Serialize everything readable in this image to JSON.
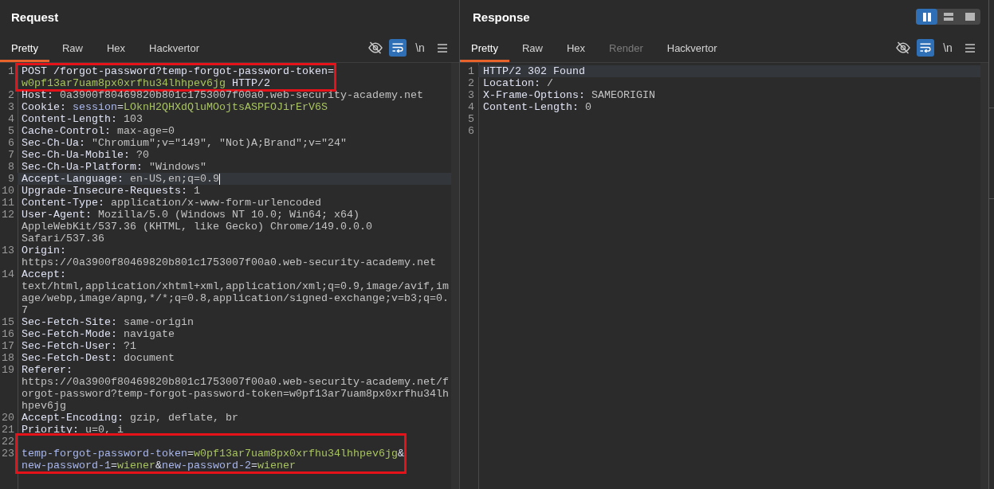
{
  "request": {
    "title": "Request",
    "focused": true,
    "tabs": [
      {
        "label": "Pretty",
        "selected": true,
        "disabled": false
      },
      {
        "label": "Raw",
        "selected": false,
        "disabled": false
      },
      {
        "label": "Hex",
        "selected": false,
        "disabled": false
      },
      {
        "label": "Hackvertor",
        "selected": false,
        "disabled": false
      }
    ],
    "toolbar": [
      {
        "kind": "hide",
        "on": false
      },
      {
        "kind": "wrap",
        "on": true
      },
      {
        "kind": "newline",
        "label": "\\n",
        "on": false
      },
      {
        "kind": "menu"
      }
    ],
    "groups": [
      {
        "boxed": true,
        "lines": [
          {
            "number": "1",
            "current": false,
            "rows": [
              {
                "parts": [
                  {
                    "kind": "name",
                    "text": "POST /forgot-password?temp-forgot-password-token="
                  }
                ]
              },
              {
                "parts": [
                  {
                    "kind": "value",
                    "text": "w0pf13ar7uam8px0xrfhu34lhhpev6jg"
                  },
                  {
                    "kind": "name",
                    "text": " HTTP/2"
                  }
                ]
              }
            ]
          }
        ]
      },
      {
        "boxed": false,
        "lines": [
          {
            "number": "2",
            "current": false,
            "rows": [
              {
                "parts": [
                  {
                    "kind": "name",
                    "text": "Host:"
                  },
                  {
                    "kind": "plain",
                    "text": " 0a3900f80469820b801c1753007f00a0.web-security-academy.net"
                  }
                ]
              }
            ]
          },
          {
            "number": "3",
            "current": false,
            "rows": [
              {
                "parts": [
                  {
                    "kind": "name",
                    "text": "Cookie: "
                  },
                  {
                    "kind": "param",
                    "text": "session"
                  },
                  {
                    "kind": "name",
                    "text": "="
                  },
                  {
                    "kind": "value",
                    "text": "LOknH2QHXdQluMOojtsASPFOJirErV6S"
                  }
                ]
              }
            ]
          },
          {
            "number": "4",
            "current": false,
            "rows": [
              {
                "parts": [
                  {
                    "kind": "name",
                    "text": "Content-Length:"
                  },
                  {
                    "kind": "plain",
                    "text": " 103"
                  }
                ]
              }
            ]
          },
          {
            "number": "5",
            "current": false,
            "rows": [
              {
                "parts": [
                  {
                    "kind": "name",
                    "text": "Cache-Control:"
                  },
                  {
                    "kind": "plain",
                    "text": " max-age=0"
                  }
                ]
              }
            ]
          },
          {
            "number": "6",
            "current": false,
            "rows": [
              {
                "parts": [
                  {
                    "kind": "name",
                    "text": "Sec-Ch-Ua:"
                  },
                  {
                    "kind": "plain",
                    "text": " \"Chromium\";v=\"149\", \"Not)A;Brand\";v=\"24\""
                  }
                ]
              }
            ]
          },
          {
            "number": "7",
            "current": false,
            "rows": [
              {
                "parts": [
                  {
                    "kind": "name",
                    "text": "Sec-Ch-Ua-Mobile:"
                  },
                  {
                    "kind": "plain",
                    "text": " ?0"
                  }
                ]
              }
            ]
          },
          {
            "number": "8",
            "current": false,
            "rows": [
              {
                "parts": [
                  {
                    "kind": "name",
                    "text": "Sec-Ch-Ua-Platform:"
                  },
                  {
                    "kind": "plain",
                    "text": " \"Windows\""
                  }
                ]
              }
            ]
          },
          {
            "number": "9",
            "current": true,
            "rows": [
              {
                "parts": [
                  {
                    "kind": "name",
                    "text": "Accept-Language:"
                  },
                  {
                    "kind": "plain",
                    "text": " en-US,en;q=0.9"
                  }
                ]
              }
            ]
          },
          {
            "number": "10",
            "current": false,
            "rows": [
              {
                "parts": [
                  {
                    "kind": "name",
                    "text": "Upgrade-Insecure-Requests:"
                  },
                  {
                    "kind": "plain",
                    "text": " 1"
                  }
                ]
              }
            ]
          },
          {
            "number": "11",
            "current": false,
            "rows": [
              {
                "parts": [
                  {
                    "kind": "name",
                    "text": "Content-Type:"
                  },
                  {
                    "kind": "plain",
                    "text": " application/x-www-form-urlencoded"
                  }
                ]
              }
            ]
          },
          {
            "number": "12",
            "current": false,
            "rows": [
              {
                "parts": [
                  {
                    "kind": "name",
                    "text": "User-Agent:"
                  },
                  {
                    "kind": "plain",
                    "text": " Mozilla/5.0 (Windows NT 10.0; Win64; x64)"
                  }
                ]
              },
              {
                "parts": [
                  {
                    "kind": "plain",
                    "text": "AppleWebKit/537.36 (KHTML, like Gecko) Chrome/149.0.0.0"
                  }
                ]
              },
              {
                "parts": [
                  {
                    "kind": "plain",
                    "text": "Safari/537.36"
                  }
                ]
              }
            ]
          },
          {
            "number": "13",
            "current": false,
            "rows": [
              {
                "parts": [
                  {
                    "kind": "name",
                    "text": "Origin:"
                  }
                ]
              },
              {
                "parts": [
                  {
                    "kind": "plain",
                    "text": "https://0a3900f80469820b801c1753007f00a0.web-security-academy.net"
                  }
                ]
              }
            ]
          },
          {
            "number": "14",
            "current": false,
            "rows": [
              {
                "parts": [
                  {
                    "kind": "name",
                    "text": "Accept:"
                  }
                ]
              },
              {
                "parts": [
                  {
                    "kind": "plain",
                    "text": "text/html,application/xhtml+xml,application/xml;q=0.9,image/avif,im"
                  }
                ]
              },
              {
                "parts": [
                  {
                    "kind": "plain",
                    "text": "age/webp,image/apng,*/*;q=0.8,application/signed-exchange;v=b3;q=0."
                  }
                ]
              },
              {
                "parts": [
                  {
                    "kind": "plain",
                    "text": "7"
                  }
                ]
              }
            ]
          },
          {
            "number": "15",
            "current": false,
            "rows": [
              {
                "parts": [
                  {
                    "kind": "name",
                    "text": "Sec-Fetch-Site:"
                  },
                  {
                    "kind": "plain",
                    "text": " same-origin"
                  }
                ]
              }
            ]
          },
          {
            "number": "16",
            "current": false,
            "rows": [
              {
                "parts": [
                  {
                    "kind": "name",
                    "text": "Sec-Fetch-Mode:"
                  },
                  {
                    "kind": "plain",
                    "text": " navigate"
                  }
                ]
              }
            ]
          },
          {
            "number": "17",
            "current": false,
            "rows": [
              {
                "parts": [
                  {
                    "kind": "name",
                    "text": "Sec-Fetch-User:"
                  },
                  {
                    "kind": "plain",
                    "text": " ?1"
                  }
                ]
              }
            ]
          },
          {
            "number": "18",
            "current": false,
            "rows": [
              {
                "parts": [
                  {
                    "kind": "name",
                    "text": "Sec-Fetch-Dest:"
                  },
                  {
                    "kind": "plain",
                    "text": " document"
                  }
                ]
              }
            ]
          },
          {
            "number": "19",
            "current": false,
            "rows": [
              {
                "parts": [
                  {
                    "kind": "name",
                    "text": "Referer:"
                  }
                ]
              },
              {
                "parts": [
                  {
                    "kind": "plain",
                    "text": "https://0a3900f80469820b801c1753007f00a0.web-security-academy.net/f"
                  }
                ]
              },
              {
                "parts": [
                  {
                    "kind": "plain",
                    "text": "orgot-password?temp-forgot-password-token=w0pf13ar7uam8px0xrfhu34lh"
                  }
                ]
              },
              {
                "parts": [
                  {
                    "kind": "plain",
                    "text": "hpev6jg"
                  }
                ]
              }
            ]
          },
          {
            "number": "20",
            "current": false,
            "rows": [
              {
                "parts": [
                  {
                    "kind": "name",
                    "text": "Accept-Encoding:"
                  },
                  {
                    "kind": "plain",
                    "text": " gzip, deflate, br"
                  }
                ]
              }
            ]
          },
          {
            "number": "21",
            "current": false,
            "rows": [
              {
                "parts": [
                  {
                    "kind": "name",
                    "text": "Priority:"
                  },
                  {
                    "kind": "plain",
                    "text": " u=0, i"
                  }
                ]
              }
            ]
          }
        ]
      },
      {
        "boxed": true,
        "lines": [
          {
            "number": "22",
            "current": false
          },
          {
            "number": "23",
            "current": false,
            "rows": [
              {
                "parts": [
                  {
                    "kind": "param",
                    "text": "temp-forgot-password-token"
                  },
                  {
                    "kind": "name",
                    "text": "="
                  },
                  {
                    "kind": "value",
                    "text": "w0pf13ar7uam8px0xrfhu34lhhpev6jg"
                  },
                  {
                    "kind": "name",
                    "text": "&"
                  }
                ]
              },
              {
                "parts": [
                  {
                    "kind": "param",
                    "text": "new-password-1"
                  },
                  {
                    "kind": "name",
                    "text": "="
                  },
                  {
                    "kind": "value",
                    "text": "wiener"
                  },
                  {
                    "kind": "name",
                    "text": "&"
                  },
                  {
                    "kind": "param",
                    "text": "new-password-2"
                  },
                  {
                    "kind": "name",
                    "text": "="
                  },
                  {
                    "kind": "value",
                    "text": "wiener"
                  }
                ]
              }
            ]
          }
        ]
      }
    ]
  },
  "response": {
    "title": "Response",
    "focused": false,
    "layout_buttons": [
      {
        "kind": "columns",
        "selected": true
      },
      {
        "kind": "rows",
        "selected": false
      },
      {
        "kind": "single",
        "selected": false
      }
    ],
    "tabs": [
      {
        "label": "Pretty",
        "selected": true,
        "disabled": false
      },
      {
        "label": "Raw",
        "selected": false,
        "disabled": false
      },
      {
        "label": "Hex",
        "selected": false,
        "disabled": false
      },
      {
        "label": "Render",
        "selected": false,
        "disabled": true
      },
      {
        "label": "Hackvertor",
        "selected": false,
        "disabled": false
      }
    ],
    "toolbar": [
      {
        "kind": "hide",
        "on": false
      },
      {
        "kind": "wrap",
        "on": true
      },
      {
        "kind": "newline",
        "label": "\\n",
        "on": false
      },
      {
        "kind": "menu"
      }
    ],
    "groups": [
      {
        "boxed": false,
        "lines": [
          {
            "number": "1",
            "current": true,
            "rows": [
              {
                "parts": [
                  {
                    "kind": "name",
                    "text": "HTTP/2 302 Found"
                  }
                ]
              }
            ]
          },
          {
            "number": "2",
            "current": false,
            "rows": [
              {
                "parts": [
                  {
                    "kind": "name",
                    "text": "Location:"
                  },
                  {
                    "kind": "plain",
                    "text": " /"
                  }
                ]
              }
            ]
          },
          {
            "number": "3",
            "current": false,
            "rows": [
              {
                "parts": [
                  {
                    "kind": "name",
                    "text": "X-Frame-Options:"
                  },
                  {
                    "kind": "plain",
                    "text": " SAMEORIGIN"
                  }
                ]
              }
            ]
          },
          {
            "number": "4",
            "current": false,
            "rows": [
              {
                "parts": [
                  {
                    "kind": "name",
                    "text": "Content-Length:"
                  },
                  {
                    "kind": "plain",
                    "text": " 0"
                  }
                ]
              }
            ]
          },
          {
            "number": "5",
            "current": false
          },
          {
            "number": "6",
            "current": false
          }
        ]
      }
    ]
  }
}
